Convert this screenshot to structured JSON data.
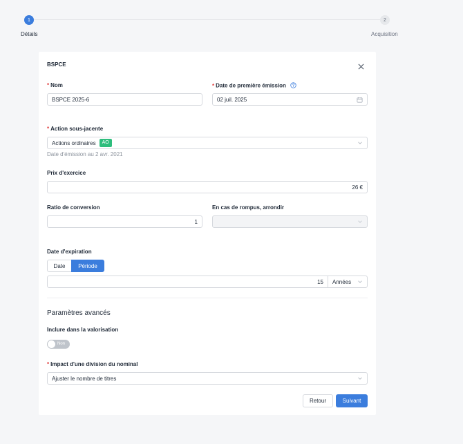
{
  "stepper": {
    "steps": [
      {
        "number": "1",
        "label": "Détails",
        "active": true
      },
      {
        "number": "2",
        "label": "Acquisition",
        "active": false
      }
    ]
  },
  "dialog": {
    "title": "BSPCE",
    "name": {
      "label": "Nom",
      "value": "BSPCE 2025-6"
    },
    "issue_date": {
      "label": "Date de première émission",
      "value": "02 juil. 2025"
    },
    "underlying": {
      "label": "Action sous-jacente",
      "value": "Actions ordinaires",
      "badge": "AO",
      "hint": "Date d'émission au 2 avr. 2021"
    },
    "exercise_price": {
      "label": "Prix d'exercice",
      "value": "26 €"
    },
    "conversion_ratio": {
      "label": "Ratio de conversion",
      "value": "1"
    },
    "rounding": {
      "label": "En cas de rompus, arrondir",
      "value": ""
    },
    "expiration": {
      "label": "Date d'expiration",
      "tabs": [
        "Date",
        "Période"
      ],
      "selected_tab": "Période",
      "value": "15",
      "unit": "Années"
    },
    "advanced": {
      "title": "Paramètres avancés",
      "include_valuation": {
        "label": "Inclure dans la valorisation",
        "toggle_text": "Non",
        "on": false
      },
      "split_impact": {
        "label": "Impact d'une division du nominal",
        "value": "Ajuster le nombre de titres"
      }
    },
    "buttons": {
      "back": "Retour",
      "next": "Suivant"
    }
  },
  "colors": {
    "primary": "#3b7ddd",
    "required": "#e03e3e",
    "badge": "#2ebd7d"
  },
  "icons": [
    "close-icon",
    "help-circle-icon",
    "calendar-icon",
    "chevron-down-icon"
  ]
}
